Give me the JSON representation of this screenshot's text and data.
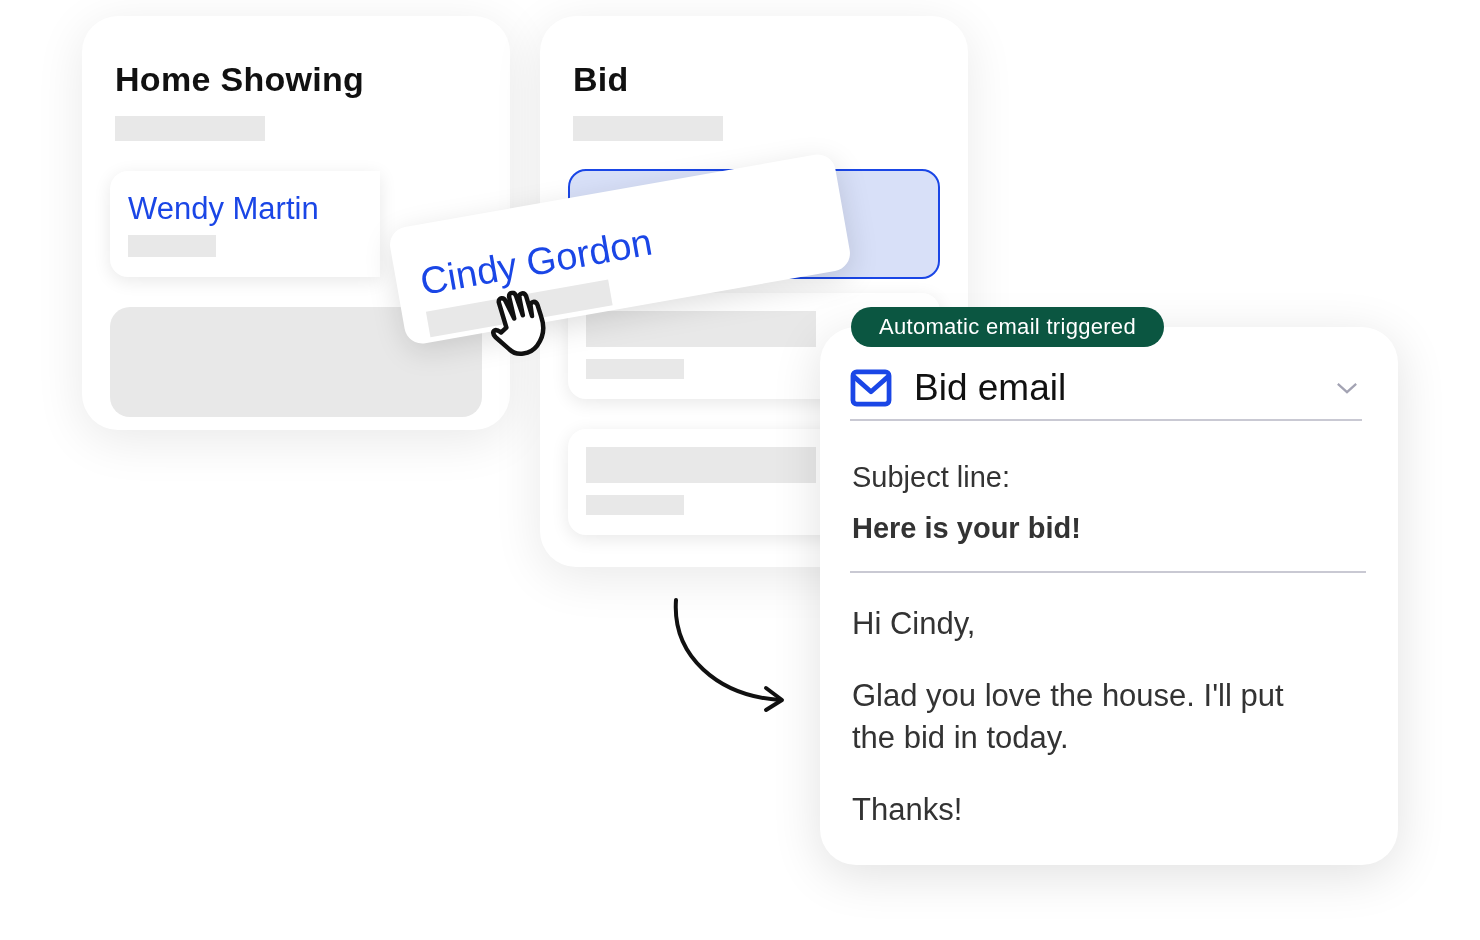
{
  "columns": [
    {
      "title": "Home Showing",
      "cards": [
        {
          "kind": "contact",
          "name": "Wendy Martin"
        },
        {
          "kind": "empty"
        }
      ]
    },
    {
      "title": "Bid",
      "cards": [
        {
          "kind": "drop-target"
        },
        {
          "kind": "skeleton"
        },
        {
          "kind": "skeleton"
        }
      ]
    }
  ],
  "dragged_card": {
    "name": "Cindy Gordon"
  },
  "email": {
    "badge": "Automatic email triggered",
    "title": "Bid email",
    "subject_label": "Subject line:",
    "subject": "Here is your bid!",
    "body": [
      "Hi Cindy,",
      "Glad you love the house. I'll put the bid in today.",
      "Thanks!"
    ]
  }
}
